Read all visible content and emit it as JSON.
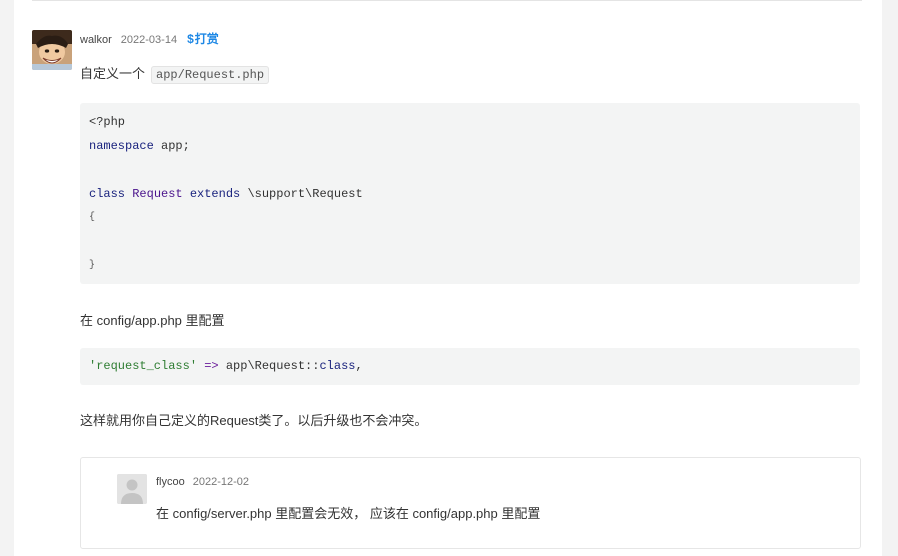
{
  "post": {
    "author": "walkor",
    "date": "2022-03-14",
    "tip_symbol": "$",
    "tip_label": "打赏",
    "intro_text": "自定义一个",
    "intro_code": "app/Request.php",
    "config_text": "在 config/app.php 里配置",
    "outro_text": "这样就用你自己定义的Request类了。以后升级也不会冲突。"
  },
  "code1": {
    "php_open": "<?php",
    "kw_namespace": "namespace",
    "namespace_name": " app;",
    "kw_class": "class",
    "class_name": " Request ",
    "kw_extends": "extends",
    "parent_class": " \\support\\Request",
    "brace_open": "{",
    "brace_close": "}"
  },
  "code2": {
    "key": "'request_class'",
    "arrow": " => ",
    "value": "app\\Request::",
    "kw_class": "class",
    "comma": ","
  },
  "reply": {
    "author": "flycoo",
    "date": "2022-12-02",
    "text": "在 config/server.php 里配置会无效， 应该在 config/app.php 里配置"
  },
  "colors": {
    "tip": "#1e88e5",
    "keyword": "#1a237e",
    "string": "#2e7d32",
    "code_bg": "#f3f4f4"
  },
  "icons": {
    "post_avatar": "avatar-image",
    "reply_avatar": "default-user-icon"
  }
}
